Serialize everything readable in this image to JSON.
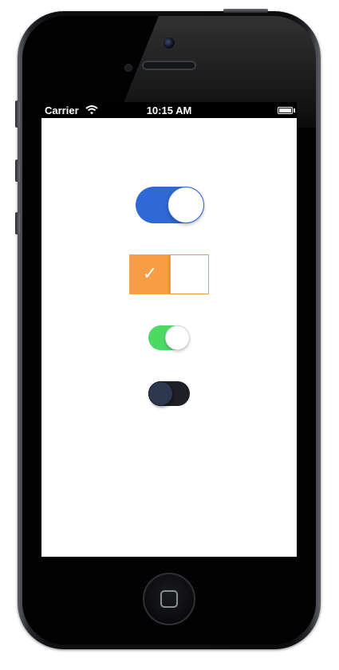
{
  "status_bar": {
    "carrier": "Carrier",
    "time": "10:15 AM",
    "icons": [
      "wifi-icon",
      "battery-icon"
    ]
  },
  "switches": [
    {
      "name": "blue-toggle",
      "on": true,
      "color": "#2f69d6"
    },
    {
      "name": "orange-checkbox-toggle",
      "on": true,
      "color": "#f79d43",
      "glyph": "✓"
    },
    {
      "name": "green-toggle",
      "on": true,
      "color": "#4cd964"
    },
    {
      "name": "dark-toggle",
      "on": false,
      "color": "#1f2026"
    }
  ]
}
